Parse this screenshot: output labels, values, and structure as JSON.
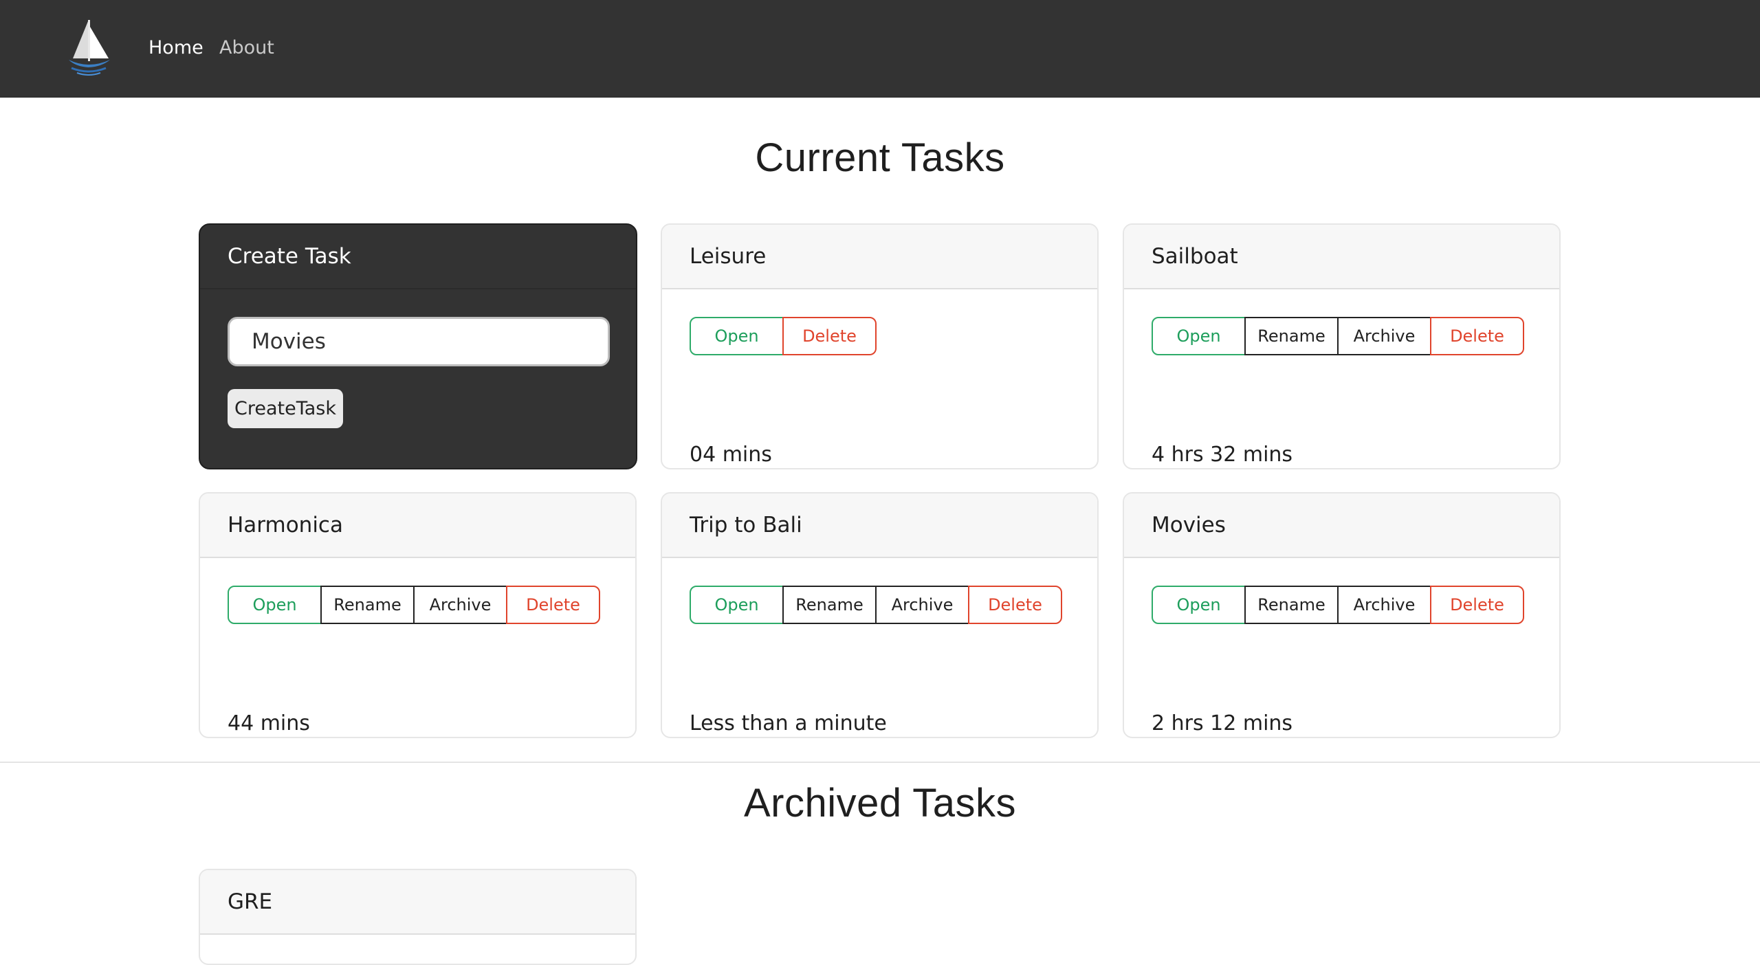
{
  "nav": {
    "links": [
      {
        "label": "Home"
      },
      {
        "label": "About"
      }
    ]
  },
  "current": {
    "title": "Current Tasks",
    "create": {
      "header": "Create Task",
      "input_value": "Movies",
      "button_label": "CreateTask"
    },
    "tasks": [
      {
        "name": "Leisure",
        "buttons": [
          "Open",
          "Delete"
        ],
        "time": "04 mins"
      },
      {
        "name": "Sailboat",
        "buttons": [
          "Open",
          "Rename",
          "Archive",
          "Delete"
        ],
        "time": "4 hrs 32 mins"
      },
      {
        "name": "Harmonica",
        "buttons": [
          "Open",
          "Rename",
          "Archive",
          "Delete"
        ],
        "time": "44 mins"
      },
      {
        "name": "Trip to Bali",
        "buttons": [
          "Open",
          "Rename",
          "Archive",
          "Delete"
        ],
        "time": "Less than a minute"
      },
      {
        "name": "Movies",
        "buttons": [
          "Open",
          "Rename",
          "Archive",
          "Delete"
        ],
        "time": "2 hrs 12 mins"
      }
    ]
  },
  "archived": {
    "title": "Archived Tasks",
    "tasks": [
      {
        "name": "GRE"
      }
    ]
  },
  "colors": {
    "navbar": "#333333",
    "open": "#2eab69",
    "delete": "#e0442c"
  },
  "icons": {
    "brand": "sailboat-logo-icon"
  }
}
